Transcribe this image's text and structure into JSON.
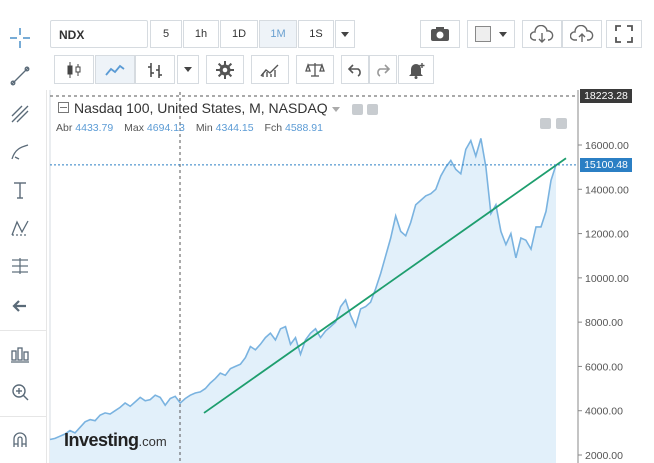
{
  "toolbar": {
    "symbol": "NDX",
    "intervals": [
      "5",
      "1h",
      "1D",
      "1M",
      "1S"
    ],
    "active_interval": "1M"
  },
  "chart_header": {
    "title": "Nasdaq 100, United States, M, NASDAQ",
    "stats": [
      {
        "label": "Abr",
        "value": "4433.79"
      },
      {
        "label": "Max",
        "value": "4694.13"
      },
      {
        "label": "Min",
        "value": "4344.15"
      },
      {
        "label": "Fch",
        "value": "4588.91"
      }
    ]
  },
  "price_tags": {
    "top": "18223.28",
    "current": "15100.48"
  },
  "colors": {
    "line": "#7ab3e0",
    "area": "#e2f0fa",
    "trend": "#1e9e6e",
    "tag_top": "#3a3a3a",
    "tag_current": "#2b7fc4"
  },
  "logo": {
    "main": "Investing",
    "suffix": ".com"
  },
  "chart_data": {
    "type": "area",
    "ylim": [
      1500,
      18223.28
    ],
    "yticks": [
      "16000.00",
      "14000.00",
      "12000.00",
      "10000.00",
      "8000.00",
      "6000.00",
      "4000.00",
      "2000.00"
    ],
    "ytick_values": [
      16000,
      14000,
      12000,
      10000,
      8000,
      6000,
      4000,
      2000
    ],
    "series": [
      {
        "values": [
          2700,
          2750,
          2850,
          2950,
          3100,
          3000,
          3250,
          3500,
          3600,
          3550,
          3800,
          3900,
          3850,
          4000,
          4150,
          4350,
          4200,
          4400,
          4600,
          4450,
          4500,
          4700,
          4600,
          4250,
          4550,
          4650,
          4350,
          4550,
          4700,
          4800,
          4850,
          5000,
          5250,
          5450,
          5700,
          5600,
          5900,
          6000,
          6100,
          6400,
          6900,
          6750,
          7000,
          7300,
          7500,
          7200,
          7700,
          7800,
          7000,
          7300,
          6550,
          7200,
          7500,
          7700,
          7300,
          7600,
          7800,
          8000,
          8700,
          9000,
          8300,
          7800,
          8600,
          8700,
          8900,
          9500,
          10200,
          11000,
          11800,
          12800,
          12100,
          11900,
          12500,
          13300,
          13500,
          13700,
          13800,
          14000,
          14600,
          15000,
          15300,
          14900,
          14700,
          15800,
          16200,
          15500,
          16300,
          15000,
          12900,
          13300,
          12100,
          11500,
          12000,
          10900,
          11800,
          11700,
          11300,
          12300,
          12300,
          13000,
          14400,
          15100
        ]
      }
    ],
    "trendline": {
      "start": 3900,
      "end": 15400
    }
  }
}
